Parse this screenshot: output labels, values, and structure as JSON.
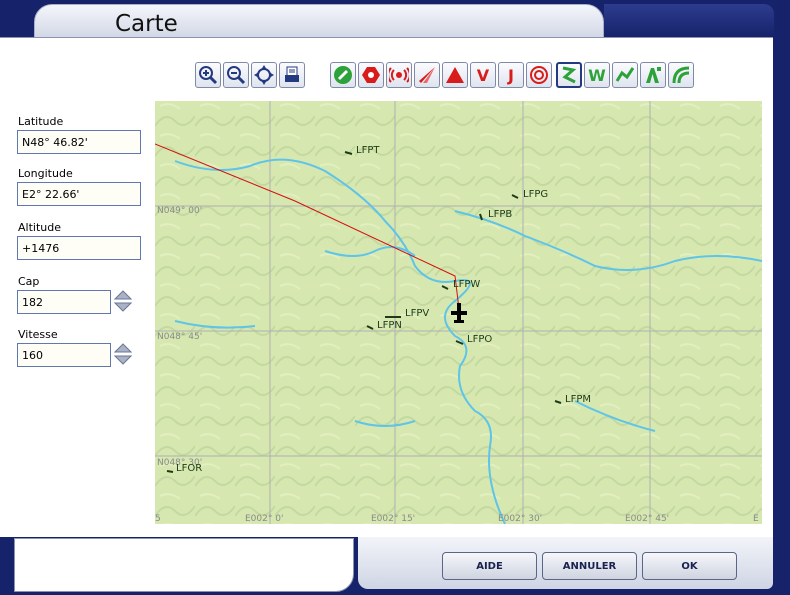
{
  "window": {
    "title": "Carte"
  },
  "toolbar": {
    "view_tools": [
      {
        "icon": "zoom-in-icon"
      },
      {
        "icon": "zoom-out-icon"
      },
      {
        "icon": "center-aircraft-icon"
      },
      {
        "icon": "print-icon"
      }
    ],
    "filters": [
      {
        "icon": "airport-filter-icon",
        "color": "#2da23a"
      },
      {
        "icon": "vor-filter-icon",
        "color": "#d81c1c"
      },
      {
        "icon": "ndb-filter-icon",
        "color": "#d81c1c"
      },
      {
        "icon": "ils-filter-icon",
        "color": "#d81c1c"
      },
      {
        "icon": "intersection-filter-icon",
        "color": "#d81c1c"
      },
      {
        "icon": "victor-airways-icon",
        "label": "V",
        "color": "#d81c1c"
      },
      {
        "icon": "jet-airways-icon",
        "label": "J",
        "color": "#d81c1c"
      },
      {
        "icon": "airspace-filter-icon",
        "color": "#d81c1c"
      },
      {
        "icon": "flight-path-icon",
        "color": "#2da23a"
      },
      {
        "icon": "weather-icon",
        "label": "W",
        "color": "#2da23a"
      },
      {
        "icon": "high-low-airways-icon",
        "color": "#2da23a"
      },
      {
        "icon": "text-labels-icon",
        "color": "#2da23a"
      },
      {
        "icon": "terrain-icon",
        "color": "#2da23a"
      }
    ]
  },
  "fields": {
    "latitude": {
      "label": "Latitude",
      "value": "N48° 46.82'"
    },
    "longitude": {
      "label": "Longitude",
      "value": "E2° 22.66'"
    },
    "altitude": {
      "label": "Altitude",
      "value": "+1476"
    },
    "cap": {
      "label": "Cap",
      "value": "182"
    },
    "vitesse": {
      "label": "Vitesse",
      "value": "160"
    }
  },
  "map": {
    "airports": [
      {
        "code": "LFPT"
      },
      {
        "code": "LFPG"
      },
      {
        "code": "LFPB"
      },
      {
        "code": "LFPW"
      },
      {
        "code": "LFPV"
      },
      {
        "code": "LFPN"
      },
      {
        "code": "LFPO"
      },
      {
        "code": "LFPM"
      },
      {
        "code": "LFOR"
      }
    ],
    "lat_labels": [
      "N049° 00'",
      "N048° 45'",
      "N048° 30'"
    ],
    "lon_labels": [
      "5",
      "E002° 0'",
      "E002° 15'",
      "E002° 30'",
      "E002° 45'",
      "E"
    ],
    "colors": {
      "terrain": "#d6e8b0",
      "water": "#5ec4e8",
      "route": "#d31010",
      "grid": "#b0b0b0"
    }
  },
  "buttons": {
    "aide": "AIDE",
    "annuler": "ANNULER",
    "ok": "OK"
  }
}
